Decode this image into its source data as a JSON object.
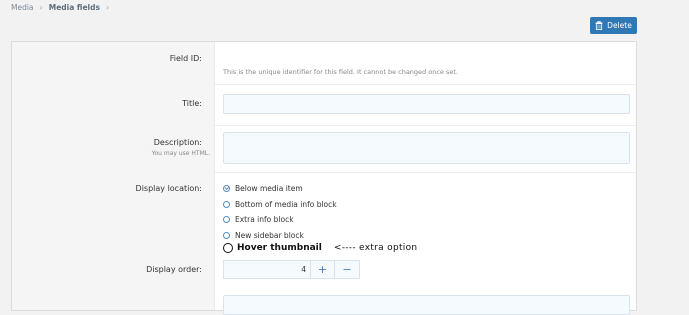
{
  "breadcrumb": {
    "items": [
      "Media",
      "Media fields"
    ],
    "separator": "›"
  },
  "toolbar": {
    "delete_label": "Delete",
    "delete_icon": "trash-icon",
    "accent": "#2f77b5"
  },
  "form": {
    "field_id": {
      "label": "Field ID:",
      "note": "This is the unique identifier for this field. It cannot be changed once set."
    },
    "title": {
      "label": "Title:",
      "value": ""
    },
    "description": {
      "label": "Description:",
      "hint": "You may use HTML.",
      "value": ""
    },
    "display_location": {
      "label": "Display location:",
      "options": [
        {
          "label": "Below media item",
          "checked": true
        },
        {
          "label": "Bottom of media info block",
          "checked": false
        },
        {
          "label": "Extra info block",
          "checked": false
        },
        {
          "label": "New sidebar block",
          "checked": false
        }
      ],
      "extra_option": {
        "label": "Hover thumbnail",
        "note": "<---- extra option"
      }
    },
    "display_order": {
      "label": "Display order:",
      "value": "4",
      "plus": "+",
      "minus": "−"
    }
  }
}
